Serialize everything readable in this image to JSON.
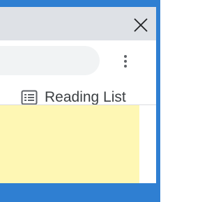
{
  "window": {
    "close_icon": "close-icon",
    "frame_color": "#2f7fd2"
  },
  "toolbar": {
    "menu_icon": "more-vert-icon"
  },
  "bookmarks_bar": {
    "reading_list_label": "Reading List",
    "reading_list_icon": "reading-list-icon"
  },
  "content": {
    "note_color": "#fef7b4"
  }
}
